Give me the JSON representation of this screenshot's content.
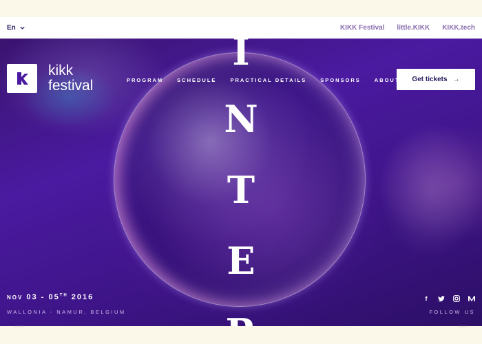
{
  "topbar": {
    "language": "En",
    "links": [
      "KIKK Festival",
      "little.KIKK",
      "KIKK.tech"
    ]
  },
  "header": {
    "logo_line1": "kikk",
    "logo_line2": "festival",
    "nav": [
      "PROGRAM",
      "SCHEDULE",
      "PRACTICAL DETAILS",
      "SPONSORS",
      "ABOUT"
    ],
    "cta_label": "Get tickets",
    "cta_arrow": "→"
  },
  "hero": {
    "vertical_letters": [
      "I",
      "N",
      "T",
      "E",
      "R"
    ]
  },
  "event": {
    "month": "NOV",
    "day_start": "03",
    "day_end": "05",
    "suffix": "TH",
    "year": "2016",
    "location": "WALLONIA - NAMUR, BELGIUM"
  },
  "social": {
    "icons": [
      "facebook-icon",
      "twitter-icon",
      "instagram-icon",
      "medium-icon"
    ],
    "follow_label": "FOLLOW US"
  },
  "colors": {
    "accent": "#2a1a5e",
    "hero_bg": "#3f158c",
    "page_bg": "#fbf8e9"
  }
}
